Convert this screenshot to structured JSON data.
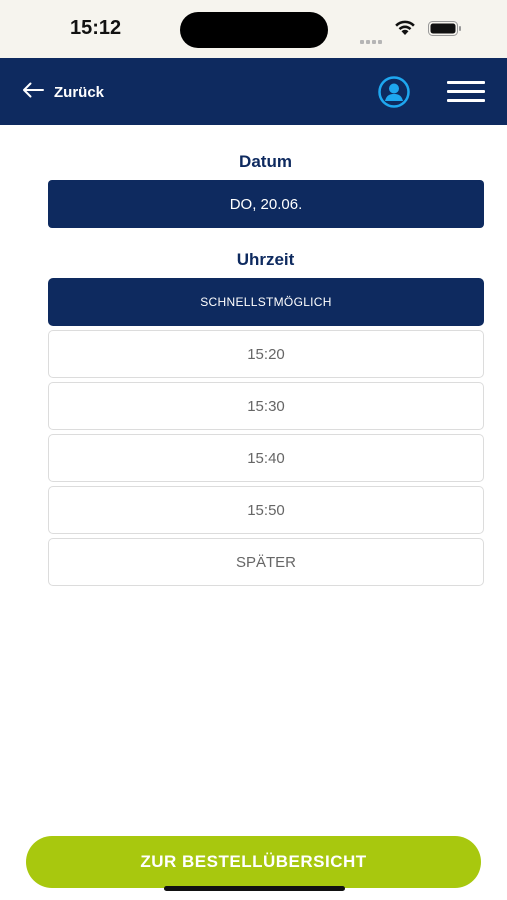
{
  "status_bar": {
    "time": "15:12"
  },
  "header": {
    "back_label": "Zurück",
    "icons": {
      "back": "arrow-left-icon",
      "profile": "user-circle-icon",
      "menu": "hamburger-menu-icon"
    },
    "colors": {
      "background": "#0e2a5f",
      "profile_icon": "#1ea7f0"
    }
  },
  "date_section": {
    "label": "Datum",
    "selected_date": "DO, 20.06."
  },
  "time_section": {
    "label": "Uhrzeit",
    "options": [
      {
        "label": "SCHNELLSTMÖGLICH",
        "selected": true
      },
      {
        "label": "15:20",
        "selected": false
      },
      {
        "label": "15:30",
        "selected": false
      },
      {
        "label": "15:40",
        "selected": false
      },
      {
        "label": "15:50",
        "selected": false
      },
      {
        "label": "SPÄTER",
        "selected": false
      }
    ]
  },
  "footer": {
    "cta_label": "ZUR BESTELLÜBERSICHT",
    "cta_color": "#a8c80e"
  }
}
